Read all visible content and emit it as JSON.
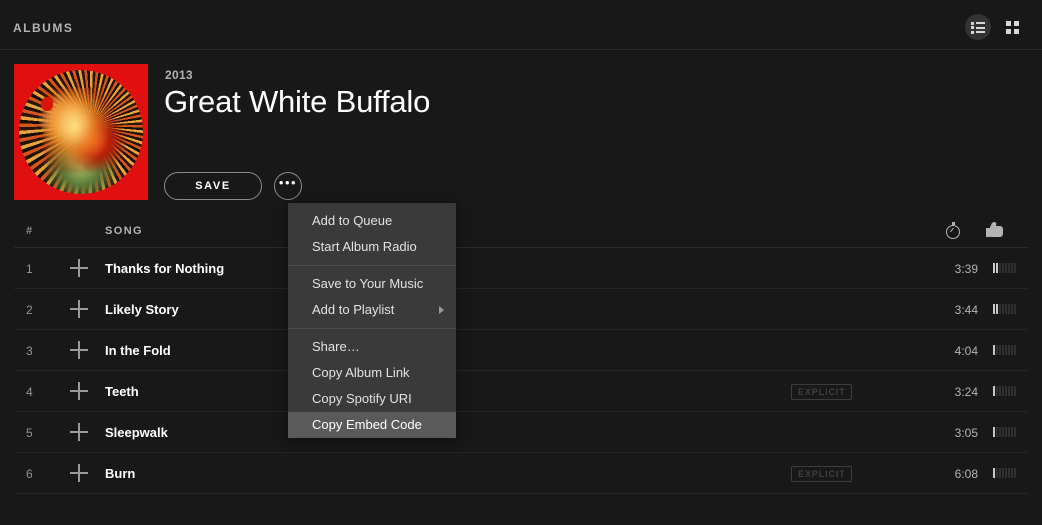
{
  "topbar": {
    "title": "ALBUMS",
    "view_list_icon": "list-view-icon",
    "view_grid_icon": "grid-view-icon",
    "active_view": "list"
  },
  "album": {
    "year": "2013",
    "title": "Great White Buffalo",
    "save_label": "SAVE",
    "more_label": "•••",
    "art_alt": "album-cover-art"
  },
  "table": {
    "headers": {
      "number": "#",
      "song": "SONG",
      "duration_icon": "stopwatch-icon",
      "popularity_icon": "thumbs-up-icon"
    },
    "rows": [
      {
        "num": "1",
        "title": "Thanks for Nothing",
        "explicit": "",
        "duration": "3:39",
        "popularity": 2
      },
      {
        "num": "2",
        "title": "Likely Story",
        "explicit": "",
        "duration": "3:44",
        "popularity": 2
      },
      {
        "num": "3",
        "title": "In the Fold",
        "explicit": "",
        "duration": "4:04",
        "popularity": 1
      },
      {
        "num": "4",
        "title": "Teeth",
        "explicit": "EXPLICIT",
        "duration": "3:24",
        "popularity": 1
      },
      {
        "num": "5",
        "title": "Sleepwalk",
        "explicit": "",
        "duration": "3:05",
        "popularity": 1
      },
      {
        "num": "6",
        "title": "Burn",
        "explicit": "EXPLICIT",
        "duration": "6:08",
        "popularity": 1
      }
    ],
    "popularity_bar_count": 8
  },
  "context_menu": {
    "groups": [
      [
        {
          "label": "Add to Queue",
          "submenu": false,
          "hover": false
        },
        {
          "label": "Start Album Radio",
          "submenu": false,
          "hover": false
        }
      ],
      [
        {
          "label": "Save to Your Music",
          "submenu": false,
          "hover": false
        },
        {
          "label": "Add to Playlist",
          "submenu": true,
          "hover": false
        }
      ],
      [
        {
          "label": "Share…",
          "submenu": false,
          "hover": false
        },
        {
          "label": "Copy Album Link",
          "submenu": false,
          "hover": false
        },
        {
          "label": "Copy Spotify URI",
          "submenu": false,
          "hover": false
        },
        {
          "label": "Copy Embed Code",
          "submenu": false,
          "hover": true
        }
      ]
    ]
  },
  "colors": {
    "background": "#181818",
    "menu_background": "#3a3a3a",
    "menu_hover": "#5a5a5a",
    "text_primary": "#ffffff",
    "text_secondary": "#b3b3b3",
    "album_art_accent": "#e01010"
  }
}
